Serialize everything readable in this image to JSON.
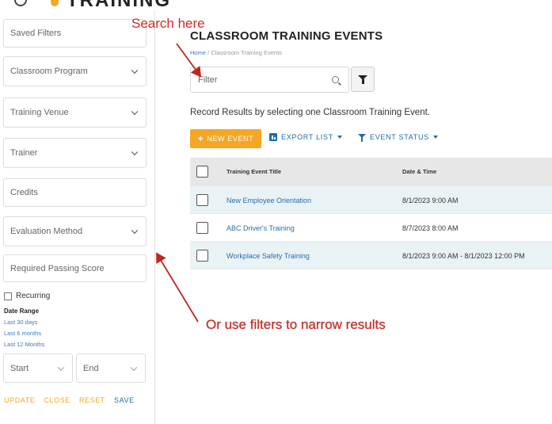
{
  "header": {
    "brand": "TRAINING"
  },
  "sidebar": {
    "fields": {
      "saved_filters": "Saved Filters",
      "classroom_program": "Classroom Program",
      "training_venue": "Training Venue",
      "trainer": "Trainer",
      "credits": "Credits",
      "evaluation_method": "Evaluation Method",
      "required_passing_score": "Required Passing Score"
    },
    "recurring_label": "Recurring",
    "date_range": {
      "label": "Date Range",
      "links": [
        "Last 30 days",
        "Last 6 months",
        "Last 12 Months"
      ]
    },
    "start_label": "Start",
    "end_label": "End",
    "actions": {
      "update": "UPDATE",
      "close": "CLOSE",
      "reset": "RESET",
      "save": "SAVE"
    }
  },
  "main": {
    "title": "CLASSROOM TRAINING EVENTS",
    "breadcrumb": {
      "home": "Home",
      "separator": " / ",
      "current": "Classroom Training Events"
    },
    "filter_placeholder": "Filter",
    "instruction": "Record Results by selecting one Classroom Training Event.",
    "toolbar": {
      "new_event": "NEW EVENT",
      "export_list": "EXPORT LIST",
      "event_status": "EVENT STATUS"
    },
    "table": {
      "columns": [
        "Training Event Title",
        "Date & Time"
      ],
      "rows": [
        {
          "title": "New Employee Orientation",
          "date": "8/1/2023 9:00 AM"
        },
        {
          "title": "ABC Driver's Training",
          "date": "8/7/2023 8:00 AM"
        },
        {
          "title": "Workplace Safety Training",
          "date": "8/1/2023 9:00 AM - 8/1/2023 12:00 PM"
        }
      ]
    }
  },
  "annotations": {
    "search_here": "Search here",
    "use_filters": "Or use filters to narrow results",
    "color": "#d12a1f"
  },
  "colors": {
    "accent_orange": "#f5a623",
    "link_blue": "#1d6fa3",
    "row_highlight": "#e9f2f5"
  }
}
